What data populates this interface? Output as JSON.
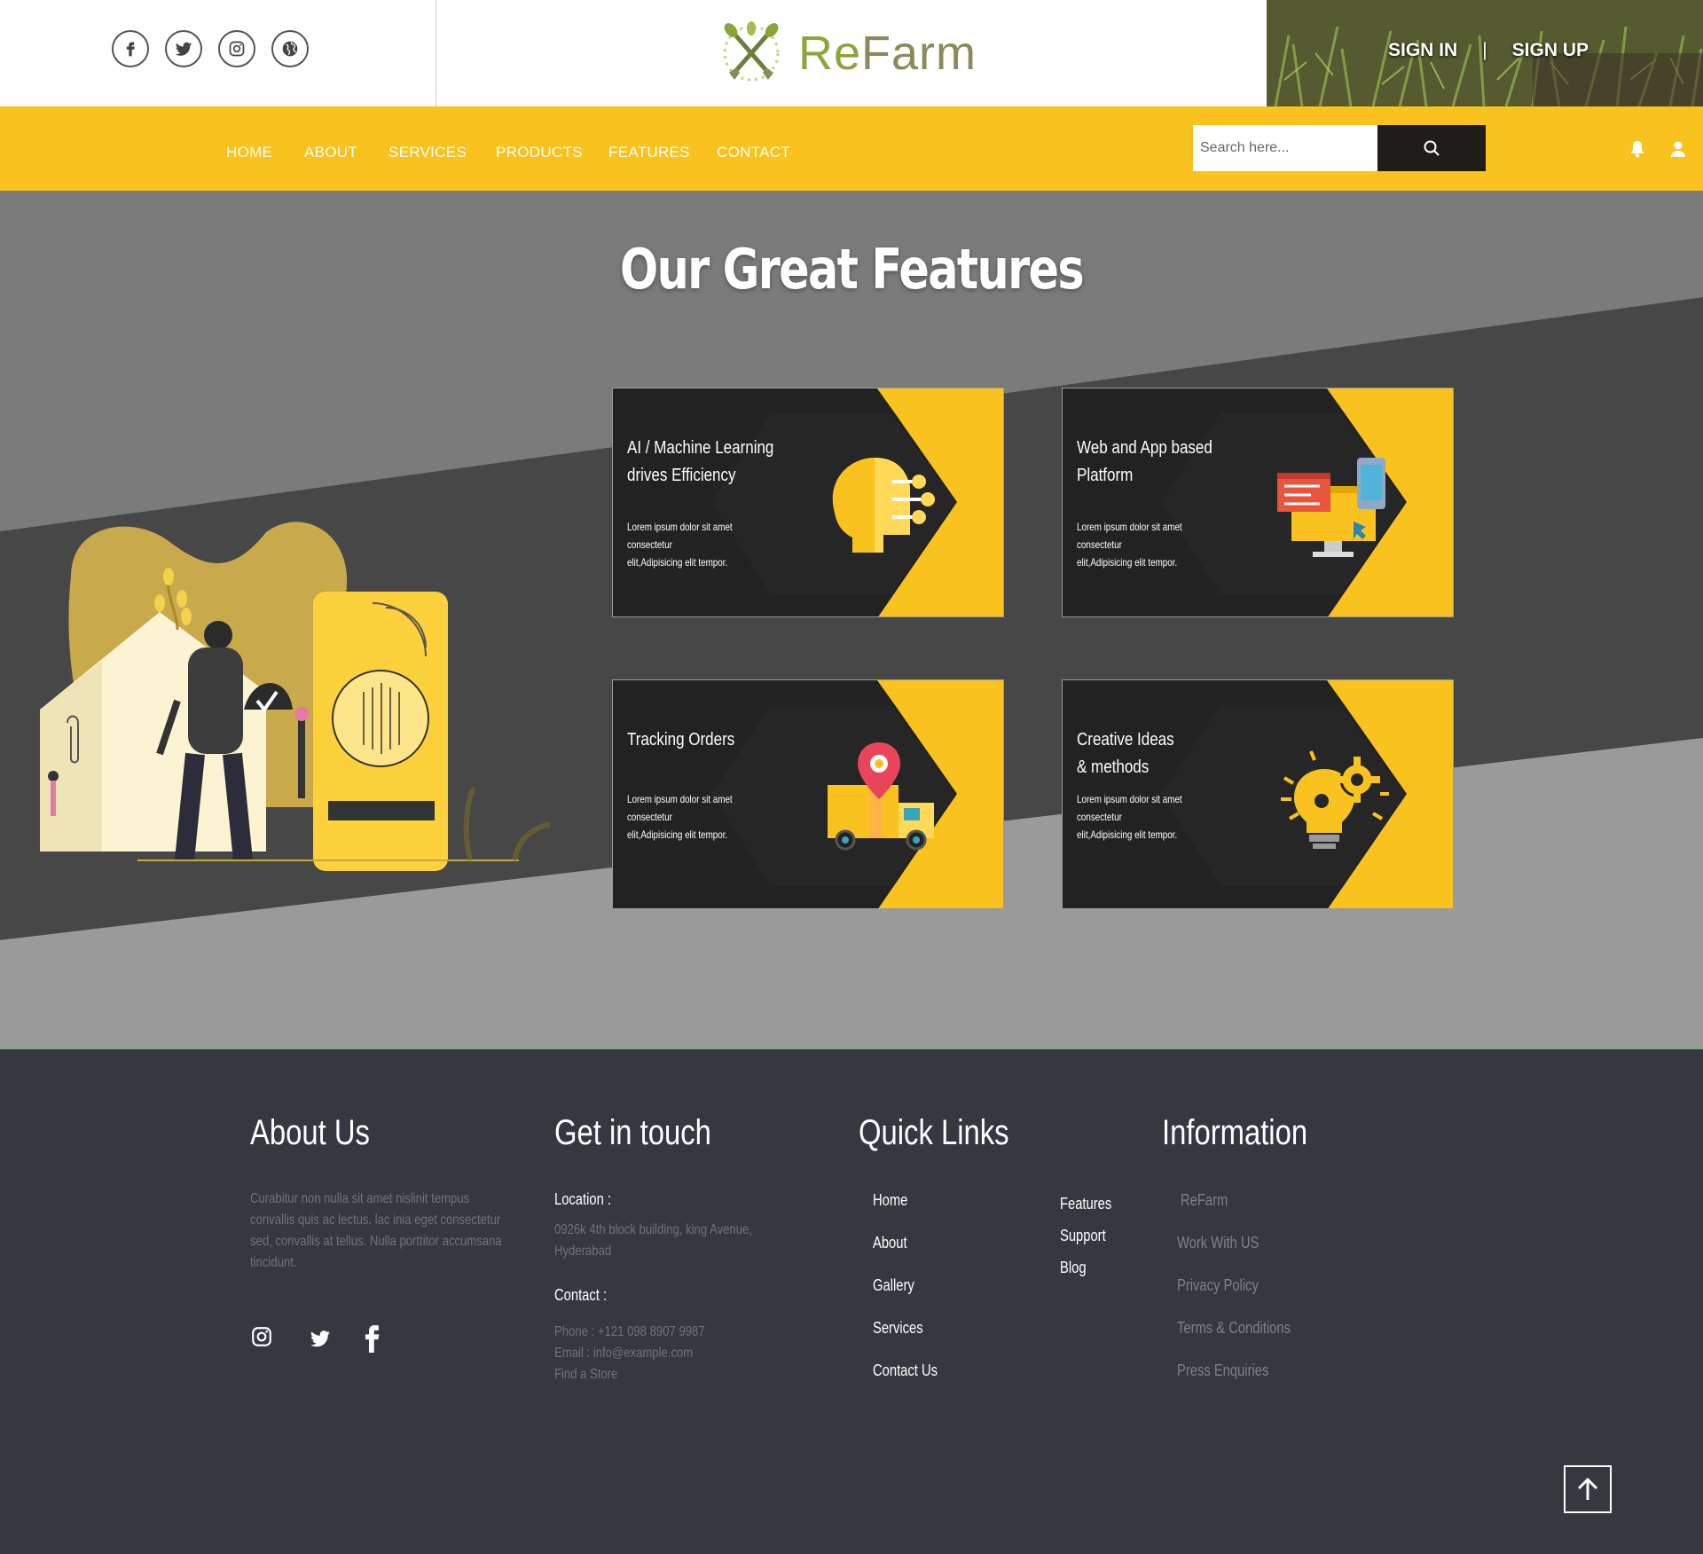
{
  "header": {
    "social_icons": [
      "facebook-icon",
      "twitter-icon",
      "instagram-icon",
      "globe-icon"
    ],
    "logo_text_re": "Re",
    "logo_text_farm": "Farm",
    "sign_in": "SIGN IN",
    "separator": "|",
    "sign_up": "SIGN UP"
  },
  "nav": {
    "items": [
      "HOME",
      "ABOUT",
      "SERVICES",
      "PRODUCTS",
      "FEATURES",
      "CONTACT"
    ],
    "search_placeholder": "Search here...",
    "search_icon": "search-icon",
    "right_icons": [
      "bell-icon",
      "user-icon"
    ]
  },
  "features": {
    "title": "Our Great Features",
    "cards": [
      {
        "title_line1": "AI / Machine Learning",
        "title_line2": "drives Efficiency",
        "body_line1": "Lorem ipsum dolor sit amet",
        "body_line2": "consectetur",
        "body_line3": "elit,Adipisicing elit tempor.",
        "icon": "ai-head-icon"
      },
      {
        "title_line1": "Web and App based",
        "title_line2": "Platform",
        "body_line1": "Lorem ipsum dolor sit amet",
        "body_line2": "consectetur",
        "body_line3": "elit,Adipisicing elit tempor.",
        "icon": "web-app-icon"
      },
      {
        "title_line1": "Tracking Orders",
        "title_line2": "",
        "body_line1": "Lorem ipsum dolor sit amet",
        "body_line2": "consectetur",
        "body_line3": "elit,Adipisicing elit tempor.",
        "icon": "delivery-truck-icon"
      },
      {
        "title_line1": "Creative Ideas",
        "title_line2": "& methods",
        "body_line1": "Lorem ipsum dolor sit amet",
        "body_line2": "consectetur",
        "body_line3": "elit,Adipisicing elit tempor.",
        "icon": "idea-gear-icon"
      }
    ],
    "colors": {
      "accent": "#f9c21e",
      "card_dark": "#222222"
    }
  },
  "footer": {
    "about": {
      "heading": "About Us",
      "text": "Curabitur non nulla sit amet nislinit tempus convallis quis ac lectus. lac inia eget consectetur  sed, convallis at tellus. Nulla porttitor accumsana  tincidunt.",
      "social_icons": [
        "instagram-icon",
        "twitter-icon",
        "facebook-icon"
      ]
    },
    "contact": {
      "heading": "Get in touch",
      "location_label": "Location :",
      "location_line1": "0926k 4th block building, king Avenue,",
      "location_line2": "Hyderabad",
      "contact_label": "Contact :",
      "phone": "Phone : +121 098 8907 9987",
      "email": "Email : info@example.com",
      "store": "Find a Store"
    },
    "quick_links": {
      "heading": "Quick Links",
      "col1": [
        "Home",
        "About",
        "Gallery",
        "Services",
        "Contact Us"
      ],
      "col2": [
        "Features",
        "Support",
        "Blog"
      ]
    },
    "information": {
      "heading": "Information",
      "items": [
        "ReFarm",
        "Work With US",
        "Privacy Policy",
        "Terms & Conditions",
        "Press Enquiries"
      ]
    },
    "back_to_top_icon": "arrow-up-icon"
  }
}
